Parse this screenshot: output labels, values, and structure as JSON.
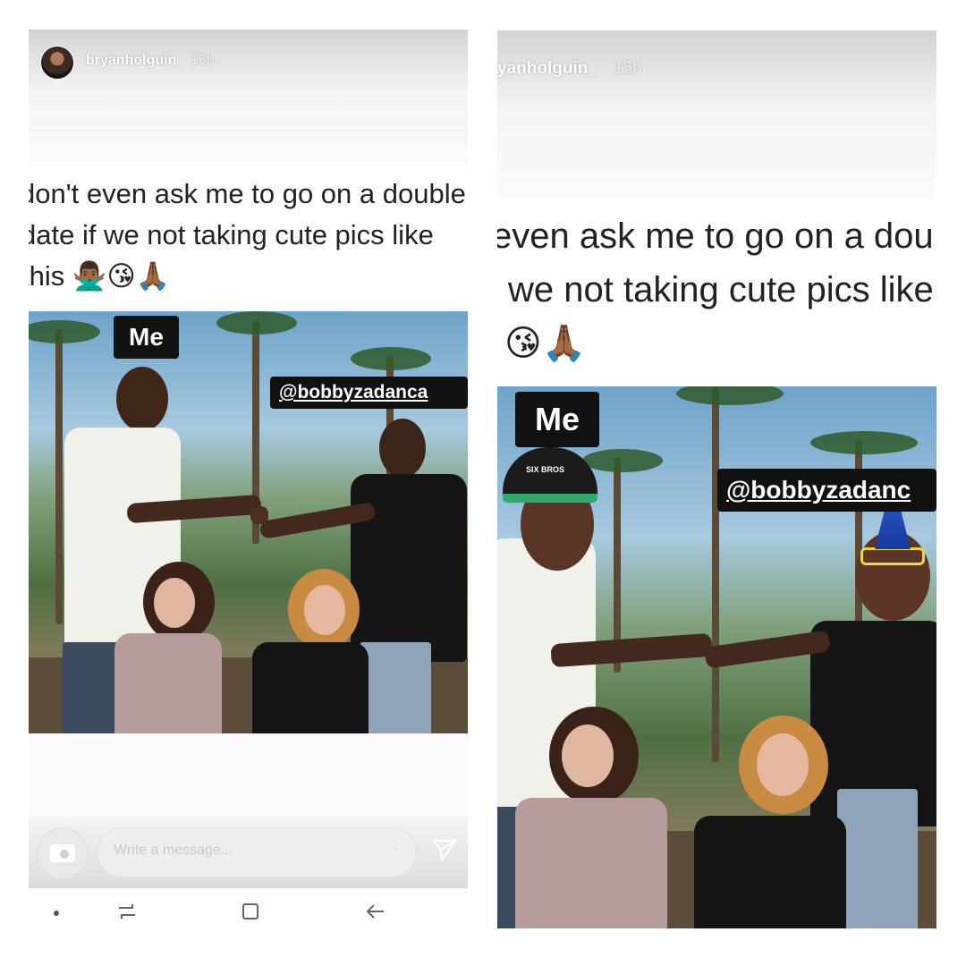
{
  "left_story": {
    "username": "bryanholguin_",
    "timestamp": "15h",
    "tweet_lines": [
      "don't even ask me to go on a double",
      "date if we not taking cute pics like",
      "this"
    ],
    "emojis": "🙅🏾‍♂️😘🙏🏾",
    "label_me": "Me",
    "label_tag": "@bobbyzadanca",
    "message_placeholder": "Write a message...",
    "more_dots": "⋮"
  },
  "right_story": {
    "username": "yanholguin_",
    "timestamp": "15h",
    "tweet_lines": [
      "even ask me to go on a dou",
      "we not taking cute pics like"
    ],
    "emojis": "😘🙏🏾",
    "label_me": "Me",
    "label_tag": "@bobbyzadanc",
    "hat_text": "SIX BROS"
  },
  "colors": {
    "label_bg": "#111111",
    "label_text": "#ffffff",
    "tweet_text": "#222222"
  },
  "icons": [
    "camera-icon",
    "send-icon",
    "more-options-icon",
    "recent-apps-icon",
    "home-icon",
    "back-icon"
  ]
}
